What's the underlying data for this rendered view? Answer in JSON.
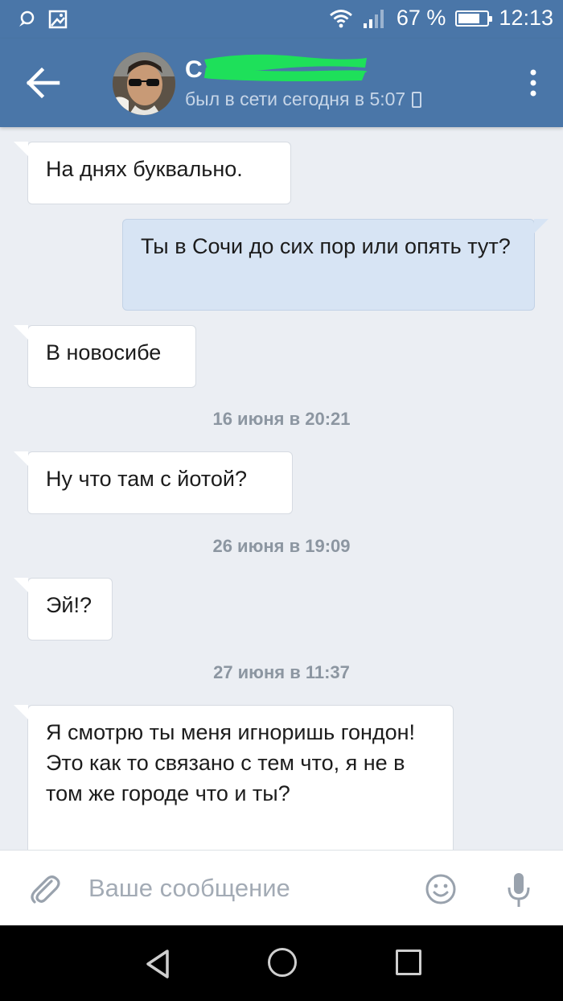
{
  "status_bar": {
    "battery_percent": "67 %",
    "battery_level": 0.67,
    "time": "12:13"
  },
  "header": {
    "contact_name": "С",
    "last_seen": "был в сети сегодня в 5:07",
    "colors": {
      "bar": "#4a76a8",
      "redaction": "#1ee05a"
    }
  },
  "messages": {
    "m1": "На днях буквально.",
    "m2": "Ты в Сочи до сих пор или опять тут?",
    "m3": "В новосибе",
    "d1": "16 июня в 20:21",
    "m4": "Ну что там с йотой?",
    "d2": "26 июня в 19:09",
    "m5": "Эй!?",
    "d3": "27 июня в 11:37",
    "m6": "Я смотрю ты меня игноришь гондон! Это как то связано с тем что, я не в том же городе что и ты?"
  },
  "composer": {
    "placeholder": "Ваше сообщение",
    "value": ""
  },
  "icons": {
    "back": "arrow-left-icon",
    "menu": "more-vertical-icon",
    "attach": "paperclip-icon",
    "emoji": "smiley-icon",
    "mic": "microphone-icon"
  }
}
